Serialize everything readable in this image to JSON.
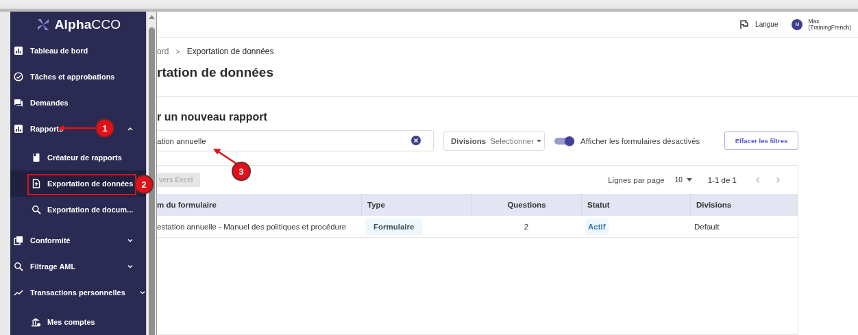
{
  "sidebar": {
    "logo": "**Alpha**CCO",
    "items": [
      {
        "label": "Tableau de bord",
        "kind": "section"
      },
      {
        "label": "Tâches et approbations",
        "kind": "section"
      },
      {
        "label": "Demandes",
        "kind": "section"
      },
      {
        "label": "Rapports",
        "kind": "section",
        "expanded": true,
        "children": [
          {
            "label": "Créateur de rapports",
            "selected": false
          },
          {
            "label": "Exportation de données",
            "selected": true
          },
          {
            "label": "Exportation de docum...",
            "selected": false
          }
        ]
      },
      {
        "label": "Conformité",
        "kind": "section",
        "expanded": false
      },
      {
        "label": "Filtrage AML",
        "kind": "section",
        "expanded": false
      },
      {
        "label": "Transactions personnelles",
        "kind": "section",
        "expanded": false
      },
      {
        "label": "Mes comptes",
        "kind": "shortcut"
      }
    ]
  },
  "header": {
    "language": "Langue",
    "user": {
      "initial": "M",
      "name": "Max",
      "account": "(TrainingFrench)"
    }
  },
  "breadcrumb": {
    "items": [
      "ord",
      "Exportation de données"
    ],
    "separator": ">"
  },
  "page_title": "rtation de données",
  "section_title": "r un nouveau rapport",
  "filters": {
    "search": {
      "value": "ation annuelle"
    },
    "divisions": {
      "label": "Divisions",
      "placeholder": "Selectionner"
    },
    "toggle": {
      "label": "Afficher les formulaires désactivés",
      "on": true
    },
    "clear_button": "Effacer les filtres"
  },
  "table": {
    "export_button": {
      "label": "vers Excel",
      "disabled": true
    },
    "pagination": {
      "rows_label": "Lignes par page",
      "rows_value": "10",
      "range": "1-1 de 1"
    },
    "columns": [
      "m du formulaire",
      "Type",
      "Questions",
      "Statut",
      "Divisions"
    ],
    "rows": [
      {
        "cells": [
          {
            "kind": "text",
            "text": "estation annuelle - Manuel des politiques et procédure"
          },
          {
            "kind": "tag",
            "text": "Formulaire"
          },
          {
            "kind": "number",
            "text": "2"
          },
          {
            "kind": "status",
            "text": "Actif"
          },
          {
            "kind": "text",
            "text": "Default"
          }
        ]
      }
    ]
  },
  "callouts": [
    {
      "number": "1"
    },
    {
      "number": "2"
    },
    {
      "number": "3"
    }
  ]
}
